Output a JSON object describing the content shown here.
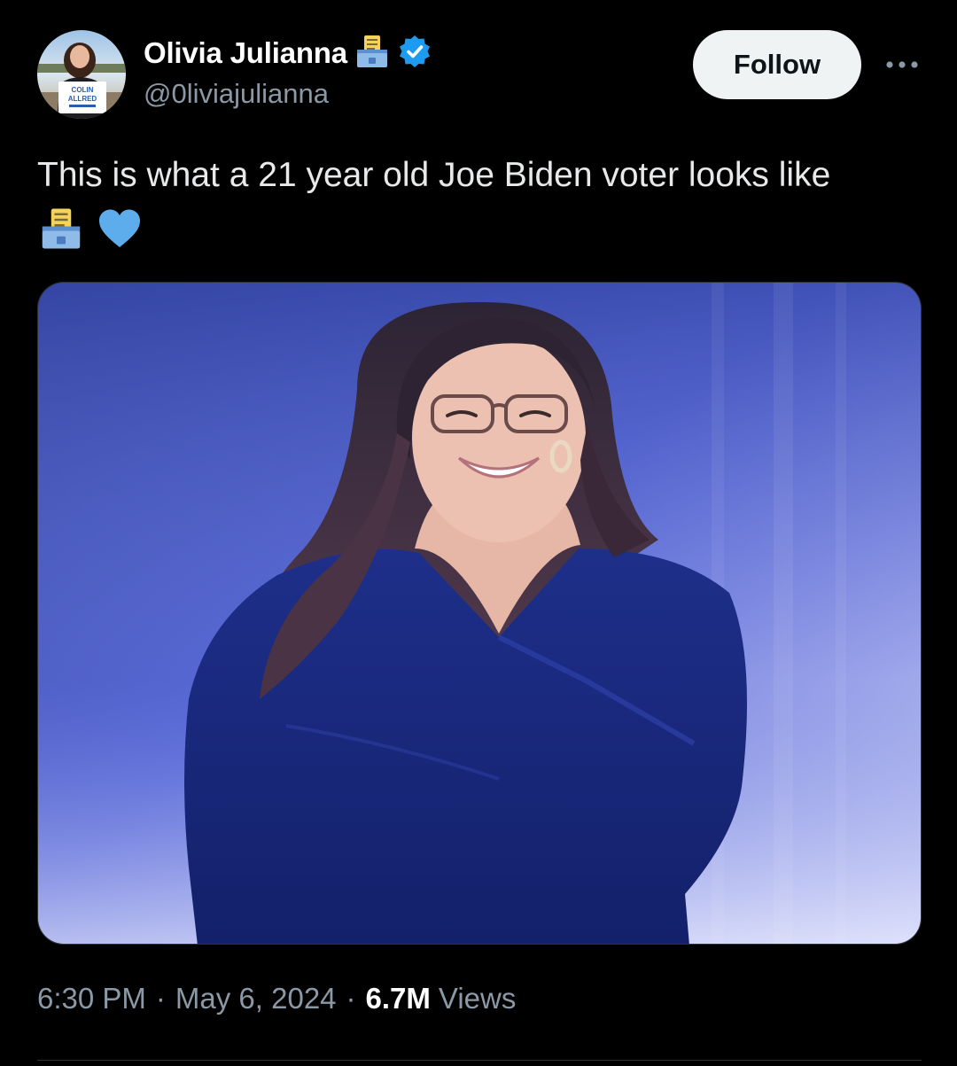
{
  "post": {
    "author": {
      "display_name": "Olivia Julianna",
      "handle": "@0liviajulianna",
      "verified": true,
      "name_emoji": "ballot-box-icon",
      "avatar_sign_text": [
        "COLIN",
        "ALLRED"
      ]
    },
    "follow_label": "Follow",
    "more_icon": "ellipsis-icon",
    "text": "This is what a 21 year old Joe Biden voter looks like",
    "text_emojis": [
      "ballot-box-icon",
      "blue-heart-icon"
    ],
    "media": {
      "type": "photo"
    },
    "meta": {
      "time": "6:30 PM",
      "date": "May 6, 2024",
      "views_count": "6.7M",
      "views_label": "Views",
      "separator": "·"
    }
  },
  "colors": {
    "background": "#000000",
    "text_primary": "#e7e9ea",
    "text_secondary": "#8b98a5",
    "verified_blue": "#1d9bf0",
    "follow_bg": "#eff3f4",
    "heart_blue": "#5dadec"
  }
}
